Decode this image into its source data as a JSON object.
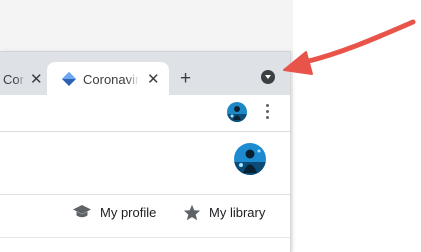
{
  "browser": {
    "tabs": [
      {
        "title": "Coronavirus",
        "active": false,
        "close_glyph": "✕"
      },
      {
        "title": "Coronavirus",
        "active": true,
        "close_glyph": "✕",
        "favicon": "scholar-cap-favicon"
      }
    ],
    "new_tab_glyph": "+",
    "tab_search_icon": "chevron-down-circle-icon",
    "toolbar": {
      "avatar_icon": "profile-avatar",
      "menu_icon": "kebab-menu-icon"
    }
  },
  "page": {
    "header": {
      "avatar_icon": "account-avatar"
    },
    "nav": {
      "my_profile": "My profile",
      "my_library": "My library",
      "profile_icon": "graduation-cap-icon",
      "library_icon": "star-icon"
    }
  },
  "annotation": {
    "arrow_color": "#e8534a",
    "arrow_icon": "curved-arrow"
  },
  "colors": {
    "tabstrip": "#dee1e6",
    "favicon_blue": "#4285f4",
    "text": "#202124"
  }
}
